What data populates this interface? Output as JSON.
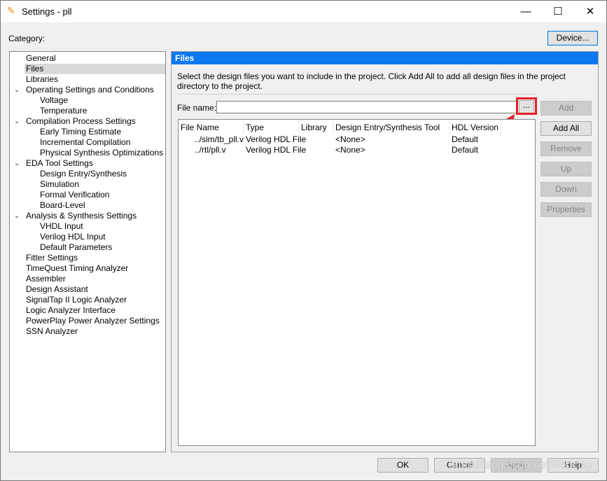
{
  "window": {
    "title": "Settings - pll",
    "minimize": "—",
    "maximize": "☐",
    "close": "✕"
  },
  "category_label": "Category:",
  "device_button": "Device...",
  "tree": [
    {
      "label": "General",
      "level": 0
    },
    {
      "label": "Files",
      "level": 0,
      "selected": true
    },
    {
      "label": "Libraries",
      "level": 0
    },
    {
      "label": "Operating Settings and Conditions",
      "level": 0,
      "expanded": true
    },
    {
      "label": "Voltage",
      "level": 1
    },
    {
      "label": "Temperature",
      "level": 1
    },
    {
      "label": "Compilation Process Settings",
      "level": 0,
      "expanded": true
    },
    {
      "label": "Early Timing Estimate",
      "level": 1
    },
    {
      "label": "Incremental Compilation",
      "level": 1
    },
    {
      "label": "Physical Synthesis Optimizations",
      "level": 1
    },
    {
      "label": "EDA Tool Settings",
      "level": 0,
      "expanded": true
    },
    {
      "label": "Design Entry/Synthesis",
      "level": 1
    },
    {
      "label": "Simulation",
      "level": 1
    },
    {
      "label": "Formal Verification",
      "level": 1
    },
    {
      "label": "Board-Level",
      "level": 1
    },
    {
      "label": "Analysis & Synthesis Settings",
      "level": 0,
      "expanded": true
    },
    {
      "label": "VHDL Input",
      "level": 1
    },
    {
      "label": "Verilog HDL Input",
      "level": 1
    },
    {
      "label": "Default Parameters",
      "level": 1
    },
    {
      "label": "Fitter Settings",
      "level": 0
    },
    {
      "label": "TimeQuest Timing Analyzer",
      "level": 0
    },
    {
      "label": "Assembler",
      "level": 0
    },
    {
      "label": "Design Assistant",
      "level": 0
    },
    {
      "label": "SignalTap II Logic Analyzer",
      "level": 0
    },
    {
      "label": "Logic Analyzer Interface",
      "level": 0
    },
    {
      "label": "PowerPlay Power Analyzer Settings",
      "level": 0
    },
    {
      "label": "SSN Analyzer",
      "level": 0
    }
  ],
  "files": {
    "header": "Files",
    "description": "Select the design files you want to include in the project. Click Add All to add all design files in the project directory to the project.",
    "file_name_label": "File name:",
    "file_name_value": "",
    "browse_button": "...",
    "columns": [
      "File Name",
      "Type",
      "Library",
      "Design Entry/Synthesis Tool",
      "HDL Version"
    ],
    "rows": [
      [
        "../sim/tb_pll.v",
        "Verilog HDL File",
        "",
        "<None>",
        "Default"
      ],
      [
        "../rtl/pll.v",
        "Verilog HDL File",
        "",
        "<None>",
        "Default"
      ]
    ],
    "buttons": {
      "add": "Add",
      "add_all": "Add All",
      "remove": "Remove",
      "up": "Up",
      "down": "Down",
      "properties": "Properties"
    }
  },
  "footer": {
    "ok": "OK",
    "cancel": "Cancel",
    "apply": "Apply",
    "help": "Help"
  },
  "watermark": "https://blog.csdn.net/Reoclay",
  "colors": {
    "accent": "#0a79f0",
    "highlight": "#e8202a"
  }
}
